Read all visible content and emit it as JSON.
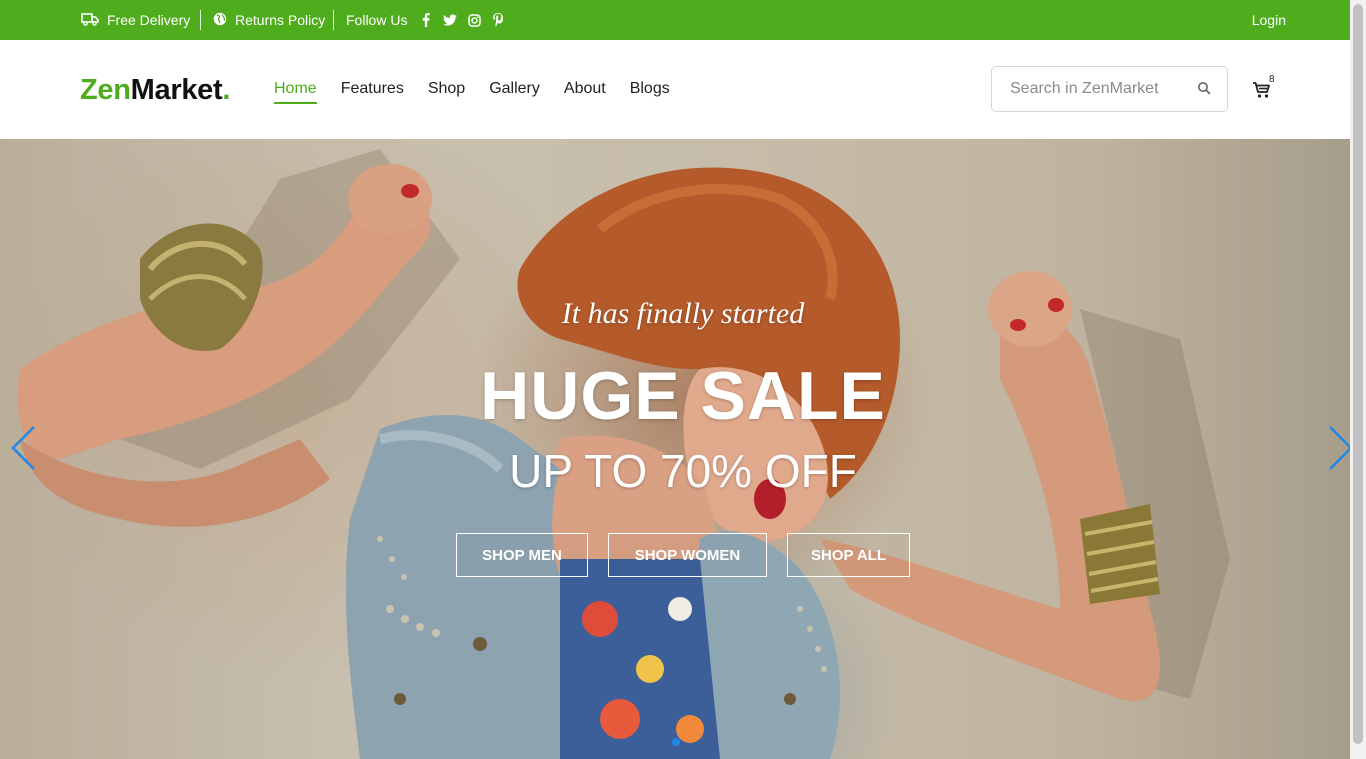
{
  "topbar": {
    "delivery": "Free Delivery",
    "returns": "Returns Policy",
    "follow": "Follow Us",
    "social_icons": [
      "facebook-icon",
      "twitter-icon",
      "instagram-icon",
      "pinterest-icon"
    ],
    "login": "Login"
  },
  "header": {
    "logo": {
      "part1": "Zen",
      "part2": "Market",
      "dot": "."
    },
    "nav": [
      "Home",
      "Features",
      "Shop",
      "Gallery",
      "About",
      "Blogs"
    ],
    "active_nav": "Home",
    "search_placeholder": "Search in ZenMarket",
    "cart_count": "8"
  },
  "hero": {
    "subhead": "It has finally started",
    "headline": "HUGE SALE",
    "offer": "UP TO 70% OFF",
    "buttons": [
      "SHOP MEN",
      "SHOP WOMEN",
      "SHOP ALL"
    ]
  },
  "colors": {
    "brand_green": "#4fac1d",
    "arrow_blue": "#1e88e5"
  }
}
